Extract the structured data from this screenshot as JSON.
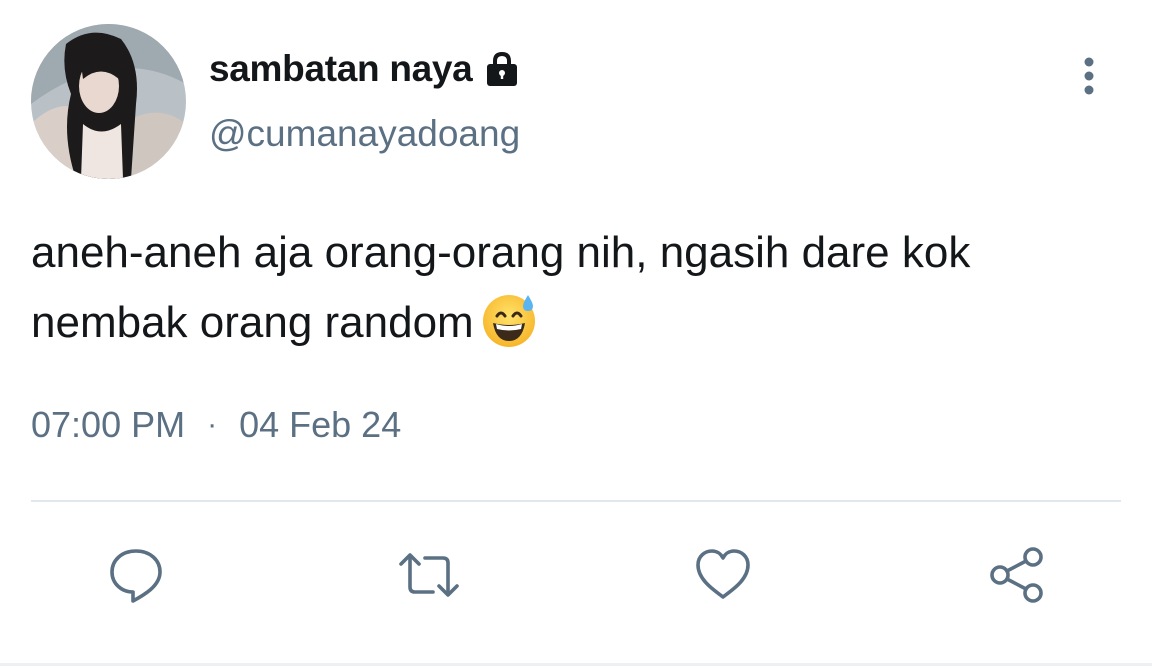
{
  "author": {
    "display_name": "sambatan naya",
    "handle": "@cumanayadoang",
    "protected_icon": "lock-icon",
    "avatar_icon": "avatar"
  },
  "tweet": {
    "text": "aneh-aneh aja orang-orang nih, ngasih dare kok nembak orang random",
    "emoji": "grinning-face-with-sweat",
    "time": "07:00 PM",
    "separator": "·",
    "date": "04 Feb 24"
  },
  "menu": {
    "icon": "more-vertical-icon"
  },
  "actions": [
    {
      "name": "reply",
      "icon": "reply-icon"
    },
    {
      "name": "retweet",
      "icon": "retweet-icon"
    },
    {
      "name": "like",
      "icon": "heart-icon"
    },
    {
      "name": "share",
      "icon": "share-icon"
    }
  ],
  "colors": {
    "text": "#14171a",
    "secondary": "#5b7083",
    "divider": "#e1e8ed",
    "icon": "#5b7083"
  }
}
